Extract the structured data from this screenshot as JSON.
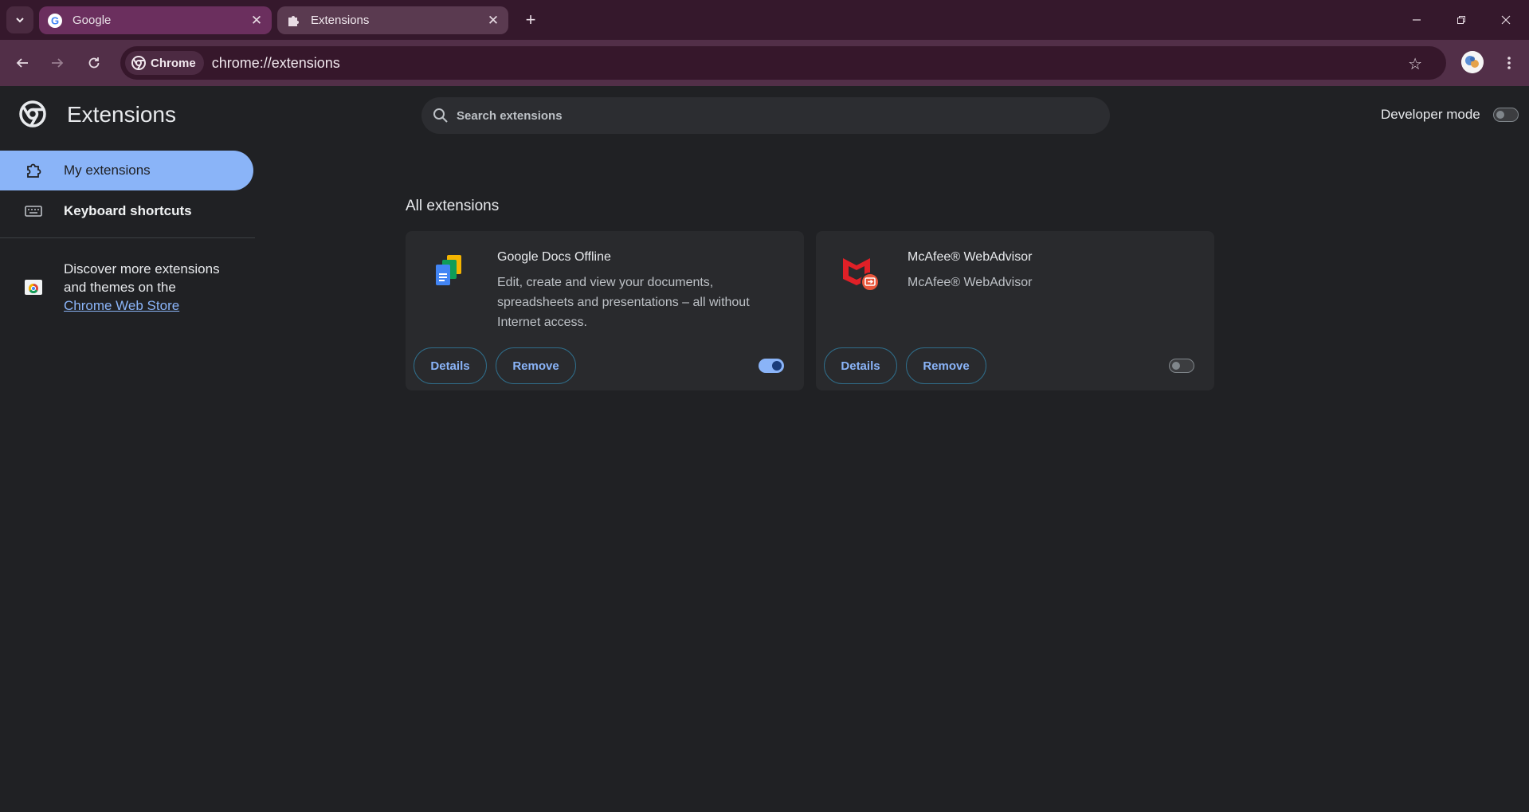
{
  "tabs": [
    {
      "title": "Google",
      "active": false
    },
    {
      "title": "Extensions",
      "active": true
    }
  ],
  "omnibox": {
    "chip": "Chrome",
    "url": "chrome://extensions"
  },
  "page": {
    "title": "Extensions",
    "search_placeholder": "Search extensions",
    "developer_mode_label": "Developer mode",
    "developer_mode_on": false
  },
  "sidebar": {
    "items": [
      {
        "label": "My extensions",
        "icon": "extension-icon"
      },
      {
        "label": "Keyboard shortcuts",
        "icon": "keyboard-icon"
      }
    ],
    "discover_text": "Discover more extensions and themes on the",
    "store_link": "Chrome Web Store"
  },
  "section_title": "All extensions",
  "extensions": [
    {
      "name": "Google Docs Offline",
      "description": "Edit, create and view your documents, spreadsheets and presentations – all without Internet access.",
      "details_label": "Details",
      "remove_label": "Remove",
      "enabled": true
    },
    {
      "name": "McAfee® WebAdvisor",
      "description": "McAfee® WebAdvisor",
      "details_label": "Details",
      "remove_label": "Remove",
      "enabled": false
    }
  ],
  "colors": {
    "accent": "#8ab4f8",
    "page_bg": "#202124",
    "card_bg": "#292a2d"
  }
}
